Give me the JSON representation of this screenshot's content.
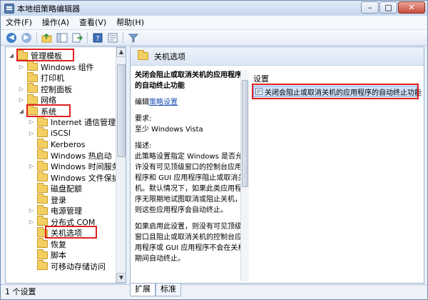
{
  "window": {
    "title": "本地组策略编辑器"
  },
  "menu": [
    "文件(F)",
    "操作(A)",
    "查看(V)",
    "帮助(H)"
  ],
  "tree": {
    "items": [
      {
        "label": "管理模板",
        "expander": "◢"
      },
      {
        "label": "Windows 组件",
        "expander": "▷"
      },
      {
        "label": "打印机",
        "expander": ""
      },
      {
        "label": "控制面板",
        "expander": "▷"
      },
      {
        "label": "网络",
        "expander": "▷"
      },
      {
        "label": "系统",
        "expander": "◢"
      },
      {
        "label": "Internet 通信管理",
        "expander": "▷"
      },
      {
        "label": "iSCSI",
        "expander": "▷"
      },
      {
        "label": "Kerberos",
        "expander": ""
      },
      {
        "label": "Windows 热启动",
        "expander": ""
      },
      {
        "label": "Windows 时间服务",
        "expander": "▷"
      },
      {
        "label": "Windows 文件保护",
        "expander": ""
      },
      {
        "label": "磁盘配额",
        "expander": ""
      },
      {
        "label": "登录",
        "expander": ""
      },
      {
        "label": "电源管理",
        "expander": "▷"
      },
      {
        "label": "分布式 COM",
        "expander": "▷"
      },
      {
        "label": "关机选项",
        "expander": ""
      },
      {
        "label": "恢复",
        "expander": ""
      },
      {
        "label": "脚本",
        "expander": ""
      },
      {
        "label": "可移动存储访问",
        "expander": ""
      }
    ]
  },
  "right": {
    "header": "关机选项",
    "desc_title": "关闭会阻止或取消关机的应用程序的自动终止功能",
    "edit_prefix": "编辑",
    "edit_link": "策略设置",
    "req_label": "要求:",
    "req_value": "至少 Windows Vista",
    "desc_label": "描述:",
    "desc_p1": "此策略设置指定 Windows 是否允许没有可见顶级窗口的控制台应用程序和 GUI 应用程序阻止或取消关机。默认情况下，如果此类应用程序无限期地试图取消或阻止关机，则这些应用程序会自动终止。",
    "desc_p2": "如果启用此设置，则没有可见顶级窗口且阻止或取消关机的控制台应用程序或 GUI 应用程序不会在关机期间自动终止。",
    "column_header": "设置",
    "setting_item": "关闭会阻止或取消关机的应用程序的自动终止功能"
  },
  "tabs": [
    "扩展",
    "标准"
  ],
  "status": "1 个设置",
  "colors": {
    "highlight": "#e02020",
    "selection": "#cfe2f9",
    "link": "#1a4fb5"
  }
}
